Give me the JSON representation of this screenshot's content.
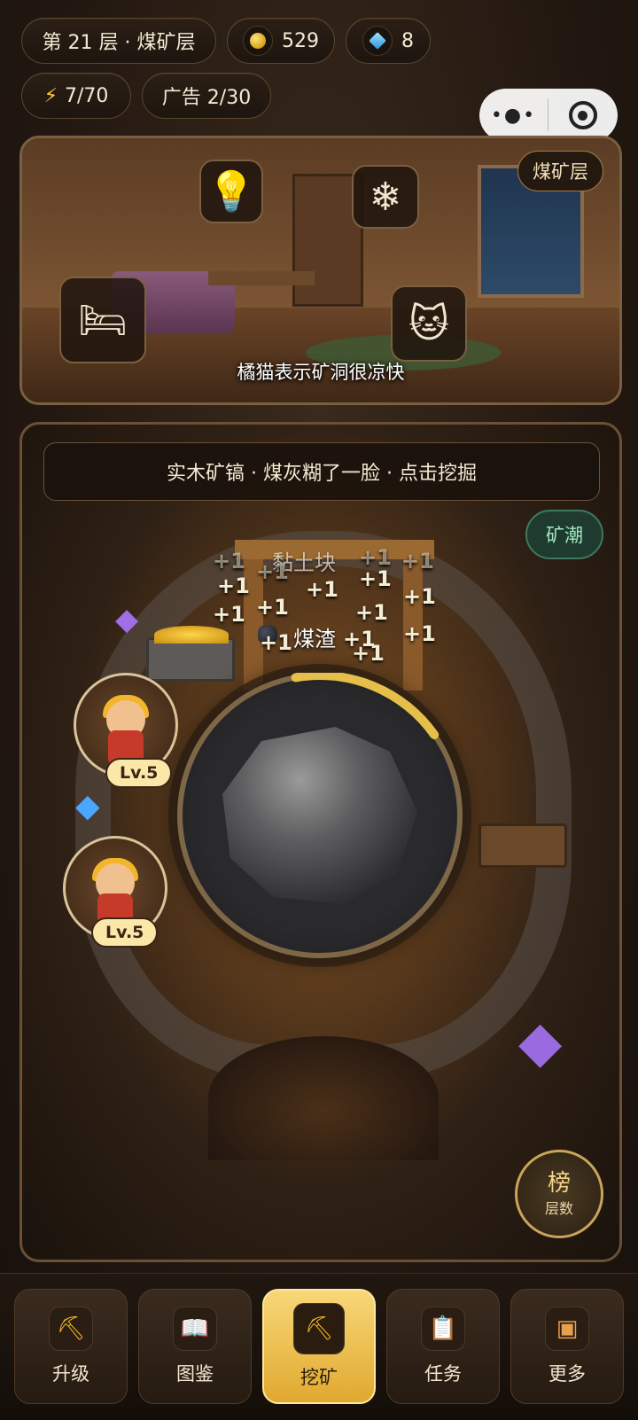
{
  "status": {
    "floor_label": "第 21 层 · 煤矿层",
    "coins": "529",
    "gems": "8",
    "energy": "7/70",
    "ads": "广告 2/30"
  },
  "room": {
    "tag": "煤矿层",
    "caption": "橘猫表示矿洞很凉快"
  },
  "mine": {
    "hint": "实木矿镐 · 煤灰糊了一脸 · 点击挖掘",
    "surge_button": "矿潮",
    "drop_labels": [
      "黏土块",
      "煤渣"
    ],
    "floaters": [
      "+1",
      "+1",
      "+1",
      "+1",
      "+1",
      "+1",
      "+1",
      "+1",
      "+1",
      "+1",
      "+1",
      "+1",
      "+1",
      "+1",
      "+1"
    ],
    "miners": [
      {
        "level": "Lv.5"
      },
      {
        "level": "Lv.5"
      }
    ],
    "dig_progress": 0.18,
    "rank_button": {
      "big": "榜",
      "small": "层数"
    }
  },
  "nav": {
    "items": [
      {
        "label": "升级",
        "icon": "pickaxe-upgrade-icon"
      },
      {
        "label": "图鉴",
        "icon": "book-icon"
      },
      {
        "label": "挖矿",
        "icon": "pickaxe-mine-icon"
      },
      {
        "label": "任务",
        "icon": "checklist-icon"
      },
      {
        "label": "更多",
        "icon": "more-box-icon"
      }
    ],
    "active": "挖矿"
  },
  "colors": {
    "accent_gold": "#e0a92f",
    "surge_green": "#9fe8c2",
    "background": "#231811"
  }
}
